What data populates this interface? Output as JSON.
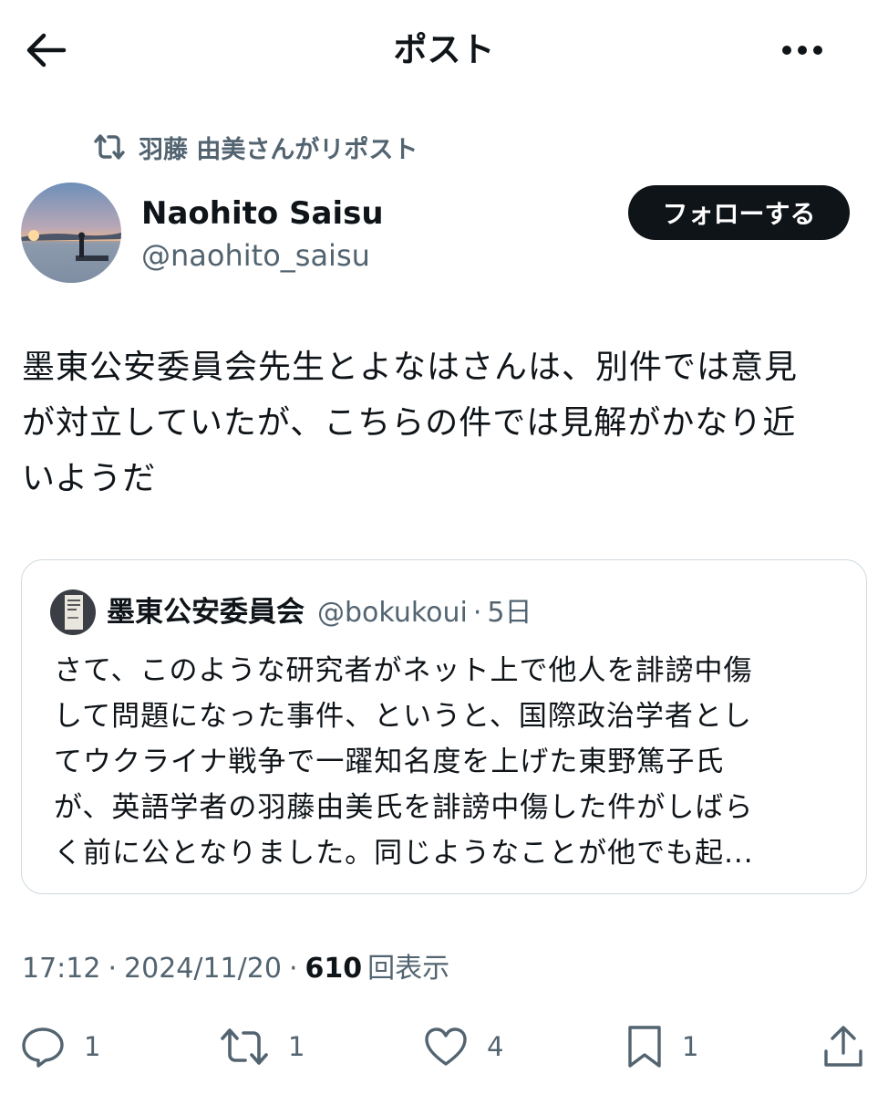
{
  "header": {
    "title": "ポスト",
    "back_icon": "arrow-left-icon",
    "more_icon": "more-horizontal-icon"
  },
  "repost": {
    "label": "羽藤 由美さんがリポスト",
    "icon": "repost-icon"
  },
  "author": {
    "name": "Naohito Saisu",
    "handle": "@naohito_saisu",
    "follow_label": "フォローする"
  },
  "post": {
    "text": "墨東公安委員会先生とよなはさんは、別件では意見\nが対立していたが、こちらの件では見解がかなり近\nいようだ"
  },
  "quote": {
    "name": "墨東公安委員会",
    "handle": "@bokukoui",
    "separator": "·",
    "time": "5日",
    "text": "さて、このような研究者がネット上で他人を誹謗中傷\nして問題になった事件、というと、国際政治学者とし\nてウクライナ戦争で一躍知名度を上げた東野篤子氏\nが、英語学者の羽藤由美氏を誹謗中傷した件がしばら\nく前に公となりました。同じようなことが他でも起..."
  },
  "meta": {
    "time": "17:12",
    "date": "2024/11/20",
    "separator": "·",
    "views": "610",
    "views_label": "回表示"
  },
  "actions": {
    "reply_count": "1",
    "repost_count": "1",
    "like_count": "4",
    "bookmark_count": "1"
  },
  "colors": {
    "text": "#0f1419",
    "secondary": "#536471",
    "border": "#cfd9de",
    "follow_bg": "#0f1419"
  }
}
